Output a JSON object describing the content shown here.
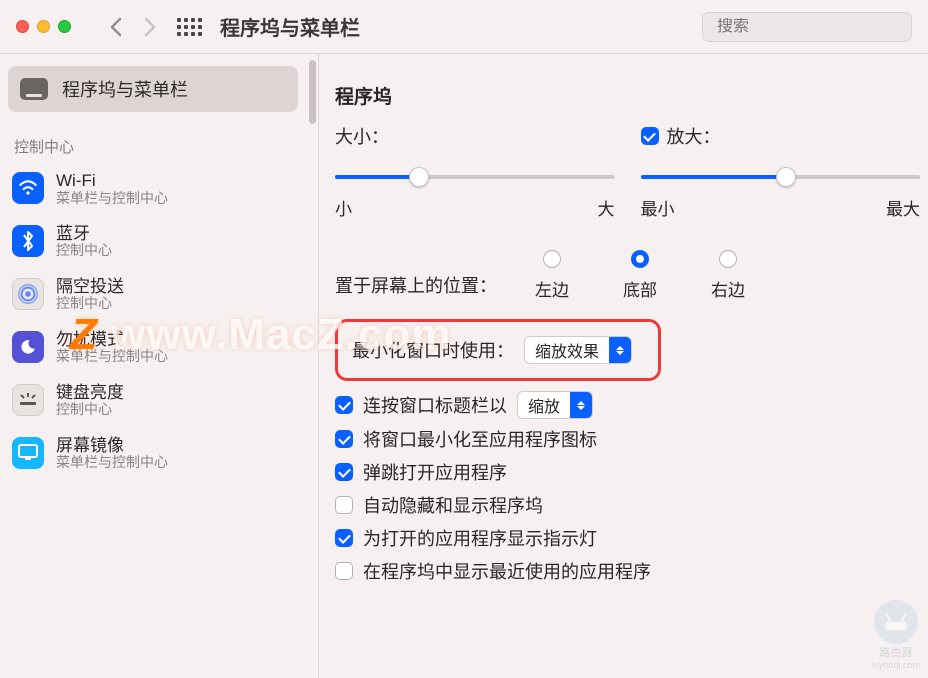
{
  "toolbar": {
    "title": "程序坞与菜单栏",
    "search_placeholder": "搜索"
  },
  "sidebar": {
    "selected": {
      "label": "程序坞与菜单栏"
    },
    "section_header": "控制中心",
    "items": [
      {
        "label": "Wi-Fi",
        "sub": "菜单栏与控制中心"
      },
      {
        "label": "蓝牙",
        "sub": "控制中心"
      },
      {
        "label": "隔空投送",
        "sub": "控制中心"
      },
      {
        "label": "勿扰模式",
        "sub": "菜单栏与控制中心"
      },
      {
        "label": "键盘亮度",
        "sub": "控制中心"
      },
      {
        "label": "屏幕镜像",
        "sub": "菜单栏与控制中心"
      }
    ]
  },
  "content": {
    "section_title": "程序坞",
    "size": {
      "label": "大小：",
      "min": "小",
      "max": "大"
    },
    "magnify": {
      "label": "放大：",
      "min": "最小",
      "max": "最大",
      "checked": true
    },
    "position": {
      "label": "置于屏幕上的位置：",
      "options": [
        "左边",
        "底部",
        "右边"
      ],
      "selected": 1
    },
    "minimize_effect": {
      "label": "最小化窗口时使用：",
      "value": "缩放效果"
    },
    "dblclick": {
      "checked": true,
      "label": "连按窗口标题栏以",
      "value": "缩放"
    },
    "opts": [
      {
        "checked": true,
        "label": "将窗口最小化至应用程序图标"
      },
      {
        "checked": true,
        "label": "弹跳打开应用程序"
      },
      {
        "checked": false,
        "label": "自动隐藏和显示程序坞"
      },
      {
        "checked": true,
        "label": "为打开的应用程序显示指示灯"
      },
      {
        "checked": false,
        "label": "在程序坞中显示最近使用的应用程序"
      }
    ]
  },
  "watermark": {
    "text": "www.MacZ.com",
    "router_label": "路由器",
    "router_sub": "luyouqi.com"
  }
}
